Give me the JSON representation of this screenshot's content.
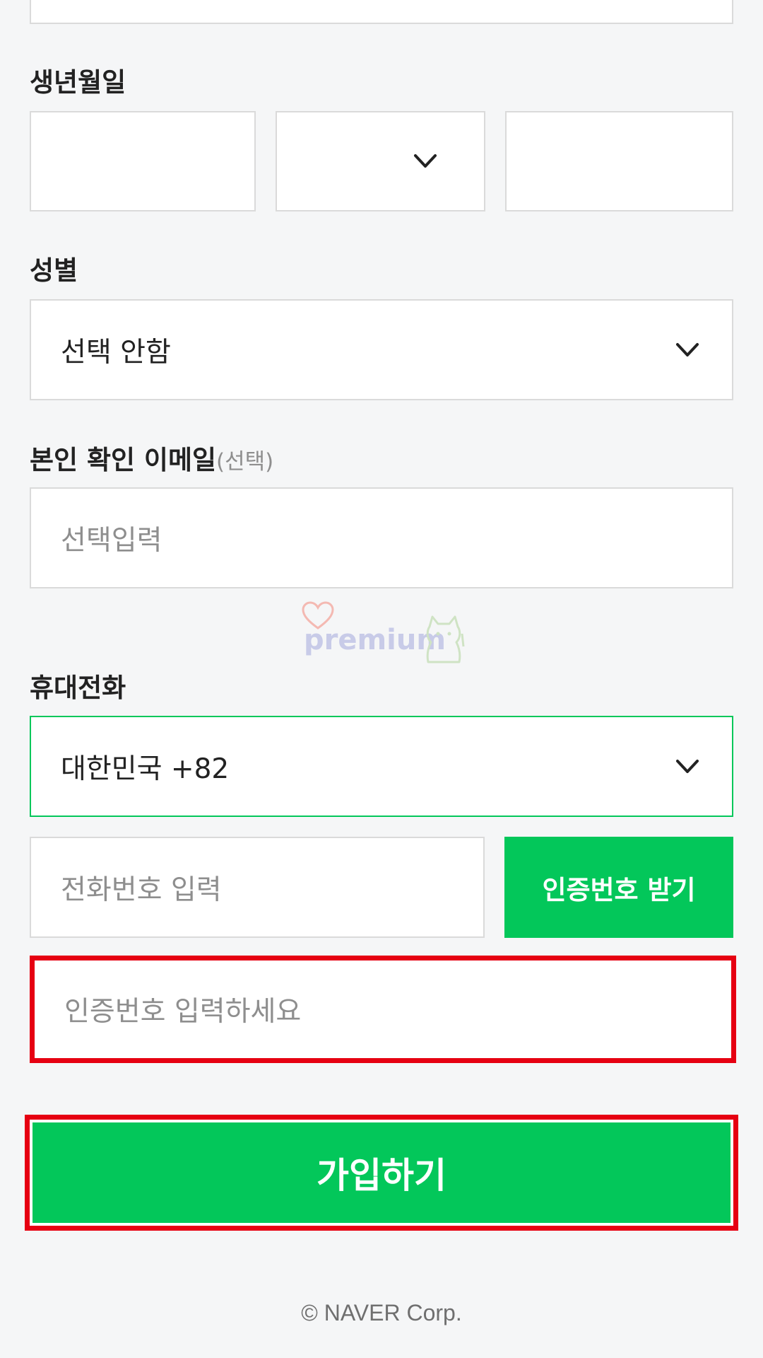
{
  "birthdate": {
    "label": "생년월일",
    "year_value": "",
    "month_value": "",
    "day_value": ""
  },
  "gender": {
    "label": "성별",
    "selected": "선택 안함"
  },
  "email": {
    "label": "본인 확인 이메일",
    "optional_tag": "(선택)",
    "placeholder": "선택입력"
  },
  "watermark": {
    "text": "premium"
  },
  "phone": {
    "label": "휴대전화",
    "country_selected": "대한민국 +82",
    "number_placeholder": "전화번호 입력",
    "request_code_button": "인증번호 받기",
    "code_placeholder": "인증번호 입력하세요"
  },
  "signup_button": "가입하기",
  "footer": "© NAVER Corp.",
  "colors": {
    "accent_green": "#03c75a",
    "highlight_red": "#e60012",
    "focus_border": "#03c75a",
    "background": "#f5f6f7"
  },
  "icons": {
    "dropdown": "chevron-down-icon",
    "watermark_heart": "heart-icon",
    "watermark_cat": "cat-icon"
  }
}
